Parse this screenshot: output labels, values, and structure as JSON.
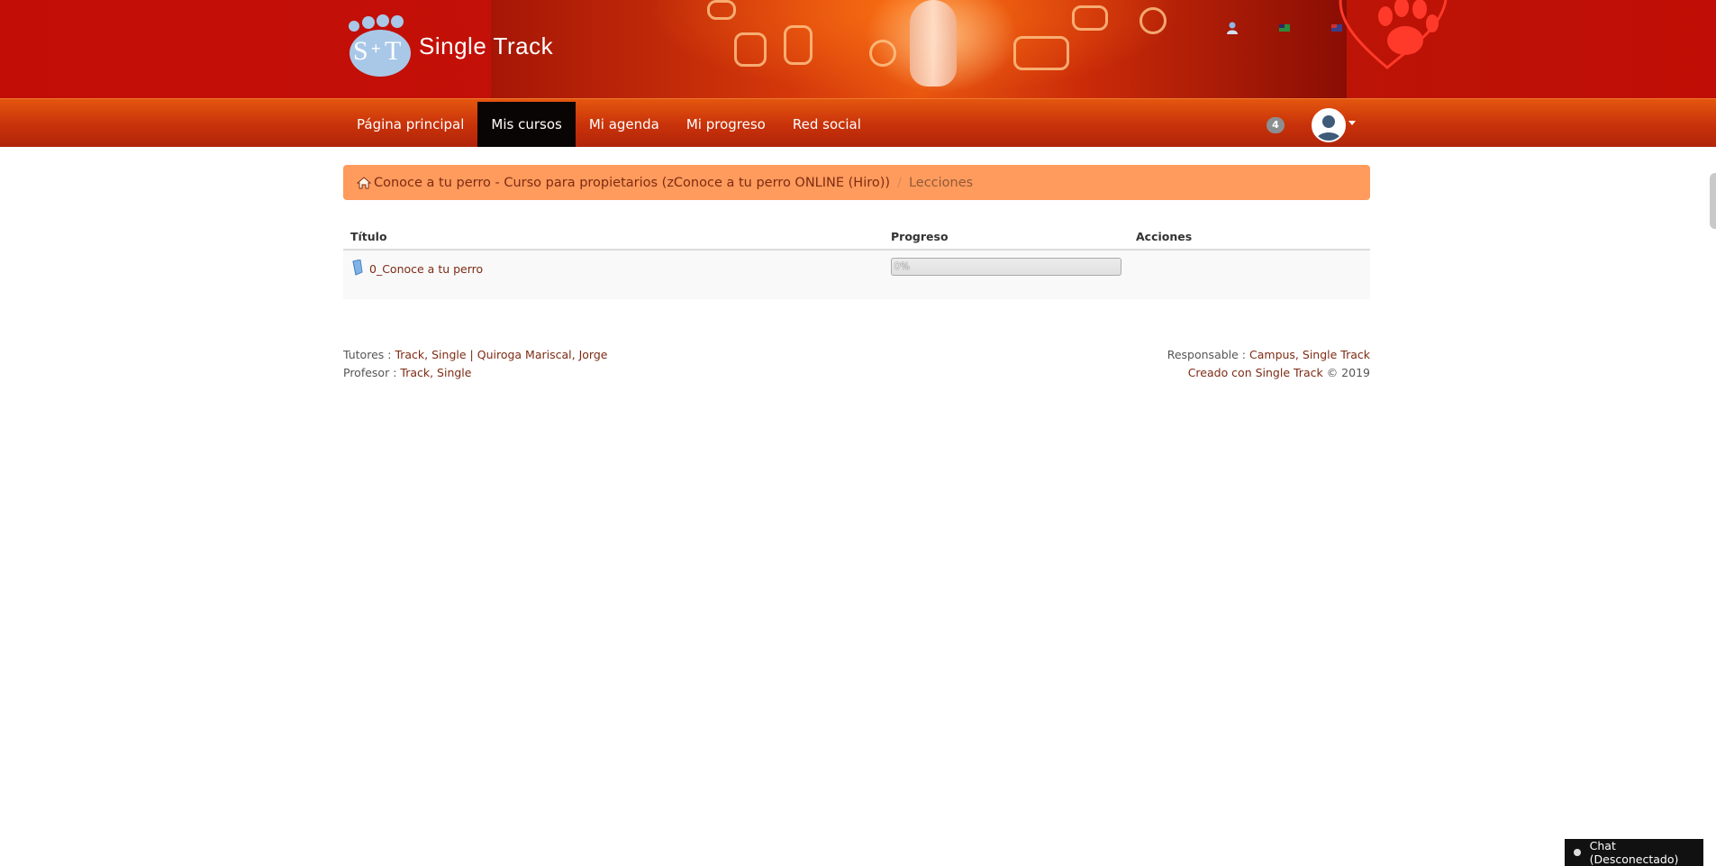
{
  "brand": {
    "name": "Single Track",
    "logo_letters": "S+T"
  },
  "header_icons": [
    "user-icon",
    "flag-icon",
    "flag-icon"
  ],
  "nav": {
    "items": [
      {
        "label": "Página principal",
        "active": false
      },
      {
        "label": "Mis cursos",
        "active": true
      },
      {
        "label": "Mi agenda",
        "active": false
      },
      {
        "label": "Mi progreso",
        "active": false
      },
      {
        "label": "Red social",
        "active": false
      }
    ],
    "notification_count": "4"
  },
  "breadcrumb": {
    "course": "Conoce a tu perro - Curso para propietarios (zConoce a tu perro ONLINE (Hiro))",
    "separator": "/",
    "current": "Lecciones"
  },
  "table": {
    "headers": {
      "title": "Título",
      "progress": "Progreso",
      "actions": "Acciones"
    },
    "rows": [
      {
        "title": "0_Conoce a tu perro",
        "progress_text": "0%",
        "progress_value": 0
      }
    ]
  },
  "footer": {
    "tutors_label": "Tutores :",
    "tutors": "Track, Single",
    "tutors_sep": "|",
    "tutors_2": "Quiroga Mariscal, Jorge",
    "teacher_label": "Profesor :",
    "teacher": "Track, Single",
    "responsible_label": "Responsable :",
    "responsible": "Campus, Single Track",
    "created_link": "Creado con Single Track",
    "created_year": "© 2019"
  },
  "chat": {
    "label": "Chat (Desconectado)"
  },
  "colors": {
    "banner": "#c10d06",
    "navbar": "#d1400c",
    "active_nav": "#0a0505",
    "breadcrumb": "#ff9b5c",
    "link": "#7d2b14"
  }
}
